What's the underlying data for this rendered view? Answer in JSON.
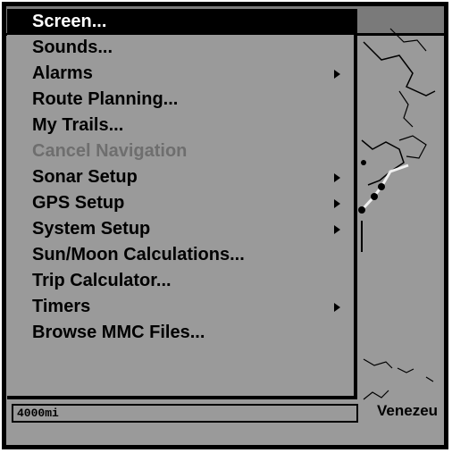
{
  "menu": {
    "items": [
      {
        "label": "Screen...",
        "selected": true,
        "enabled": true,
        "submenu": false
      },
      {
        "label": "Sounds...",
        "selected": false,
        "enabled": true,
        "submenu": false
      },
      {
        "label": "Alarms",
        "selected": false,
        "enabled": true,
        "submenu": true
      },
      {
        "label": "Route Planning...",
        "selected": false,
        "enabled": true,
        "submenu": false
      },
      {
        "label": "My Trails...",
        "selected": false,
        "enabled": true,
        "submenu": false
      },
      {
        "label": "Cancel Navigation",
        "selected": false,
        "enabled": false,
        "submenu": false
      },
      {
        "label": "Sonar Setup",
        "selected": false,
        "enabled": true,
        "submenu": true
      },
      {
        "label": "GPS Setup",
        "selected": false,
        "enabled": true,
        "submenu": true
      },
      {
        "label": "System Setup",
        "selected": false,
        "enabled": true,
        "submenu": true
      },
      {
        "label": "Sun/Moon Calculations...",
        "selected": false,
        "enabled": true,
        "submenu": false
      },
      {
        "label": "Trip Calculator...",
        "selected": false,
        "enabled": true,
        "submenu": false
      },
      {
        "label": "Timers",
        "selected": false,
        "enabled": true,
        "submenu": true
      },
      {
        "label": "Browse MMC Files...",
        "selected": false,
        "enabled": true,
        "submenu": false
      }
    ]
  },
  "map": {
    "scale_label": "4000mi",
    "place_label": "Venezeu"
  },
  "colors": {
    "background": "#9a9a9a",
    "selected_bg": "#000000",
    "selected_text": "#ffffff",
    "disabled_text": "#6e6e6e"
  },
  "icons": {
    "submenu_indicator": "triangle-right-icon"
  }
}
